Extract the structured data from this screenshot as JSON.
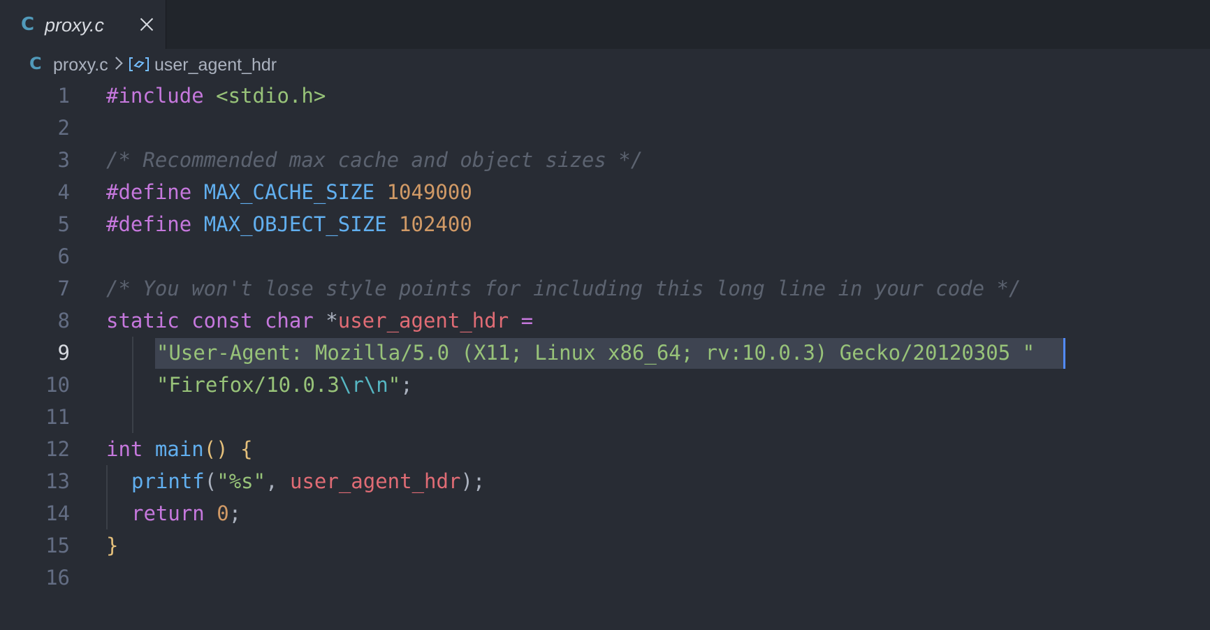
{
  "tab": {
    "title": "proxy.c",
    "icon": "c-language-icon"
  },
  "breadcrumb": {
    "file": "proxy.c",
    "symbol": "user_agent_hdr"
  },
  "editor": {
    "active_line": 9,
    "line_numbers": [
      "1",
      "2",
      "3",
      "4",
      "5",
      "6",
      "7",
      "8",
      "9",
      "10",
      "11",
      "12",
      "13",
      "14",
      "15",
      "16"
    ],
    "lines": [
      [
        [
          "kw",
          "#include "
        ],
        [
          "str",
          "<stdio.h>"
        ]
      ],
      [],
      [
        [
          "com",
          "/* Recommended max cache and object sizes */"
        ]
      ],
      [
        [
          "kw",
          "#define "
        ],
        [
          "fn",
          "MAX_CACHE_SIZE "
        ],
        [
          "num",
          "1049000"
        ]
      ],
      [
        [
          "kw",
          "#define "
        ],
        [
          "fn",
          "MAX_OBJECT_SIZE "
        ],
        [
          "num",
          "102400"
        ]
      ],
      [],
      [
        [
          "com",
          "/* You won't lose style points for including this long line in your code */"
        ]
      ],
      [
        [
          "kw",
          "static const char "
        ],
        [
          "punc",
          "*"
        ],
        [
          "var",
          "user_agent_hdr "
        ],
        [
          "kw",
          "="
        ]
      ],
      [
        [
          "str",
          "\"User-Agent: Mozilla/5.0 (X11; Linux x86_64; rv:10.0.3) Gecko/20120305 \""
        ]
      ],
      [
        [
          "str",
          "\"Firefox/10.0.3"
        ],
        [
          "esc",
          "\\r\\n"
        ],
        [
          "str",
          "\""
        ],
        [
          "punc",
          ";"
        ]
      ],
      [],
      [
        [
          "kw",
          "int "
        ],
        [
          "fn",
          "main"
        ],
        [
          "brace",
          "() {"
        ]
      ],
      [
        [
          "fn",
          "printf"
        ],
        [
          "punc",
          "("
        ],
        [
          "str",
          "\"%s\""
        ],
        [
          "punc",
          ", "
        ],
        [
          "var",
          "user_agent_hdr"
        ],
        [
          "punc",
          ");"
        ]
      ],
      [
        [
          "kw",
          "return "
        ],
        [
          "num",
          "0"
        ],
        [
          "punc",
          ";"
        ]
      ],
      [
        [
          "brace",
          "}"
        ]
      ],
      []
    ],
    "indents": [
      0,
      0,
      0,
      0,
      0,
      0,
      0,
      0,
      2,
      2,
      0,
      0,
      1,
      1,
      0,
      0
    ]
  },
  "colors": {
    "background": "#282c34",
    "keyword": "#c678dd",
    "function": "#61afef",
    "string": "#98c379",
    "number": "#d19a66",
    "comment": "#5c6370",
    "variable": "#e06c75",
    "escape": "#56b6c2",
    "brace": "#e5c07b",
    "cursor": "#528bff"
  }
}
